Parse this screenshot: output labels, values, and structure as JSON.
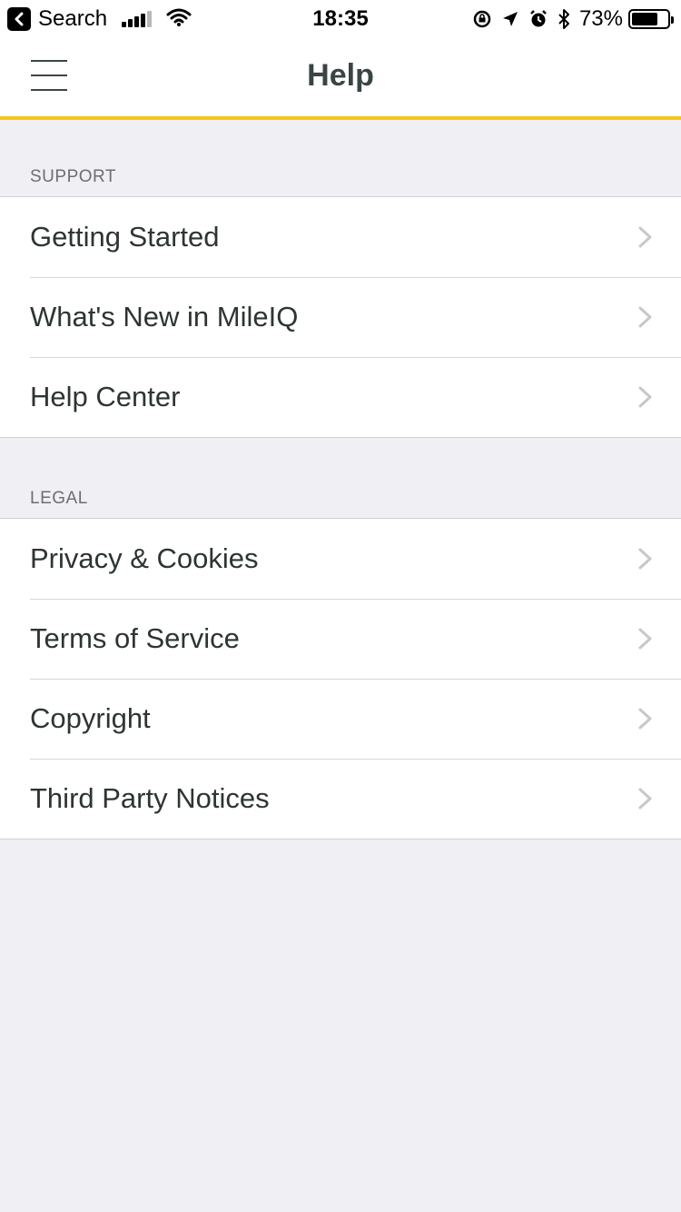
{
  "status_bar": {
    "back_app": "Search",
    "time": "18:35",
    "battery_percent": "73%",
    "battery_level": 0.73
  },
  "nav": {
    "title": "Help",
    "accent_color": "#f9c515"
  },
  "sections": [
    {
      "header": "SUPPORT",
      "items": [
        {
          "label": "Getting Started"
        },
        {
          "label": "What's New in MileIQ"
        },
        {
          "label": "Help Center"
        }
      ]
    },
    {
      "header": "LEGAL",
      "items": [
        {
          "label": "Privacy & Cookies"
        },
        {
          "label": "Terms of Service"
        },
        {
          "label": "Copyright"
        },
        {
          "label": "Third Party Notices"
        }
      ]
    }
  ]
}
